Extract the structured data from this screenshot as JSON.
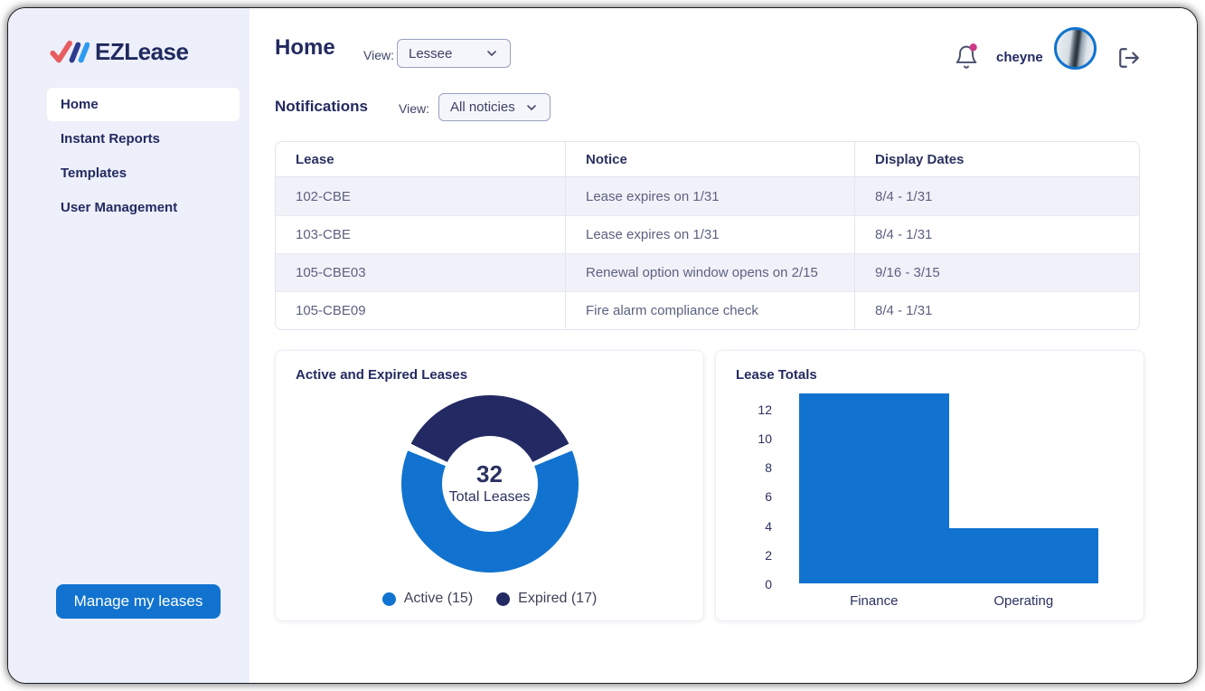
{
  "sidebar": {
    "logo_text": "EZLease",
    "items": [
      {
        "label": "Home",
        "active": true
      },
      {
        "label": "Instant Reports",
        "active": false
      },
      {
        "label": "Templates",
        "active": false
      },
      {
        "label": "User Management",
        "active": false
      }
    ],
    "manage_button_label": "Manage my leases"
  },
  "header": {
    "title": "Home",
    "view_label": "View:",
    "view_value": "Lessee",
    "username": "cheyne",
    "notification_badge": true
  },
  "notifications": {
    "title": "Notifications",
    "view_label": "View:",
    "view_value": "All noticies"
  },
  "table": {
    "columns": [
      "Lease",
      "Notice",
      "Display Dates"
    ],
    "rows": [
      {
        "lease": "102-CBE",
        "notice": "Lease expires on 1/31",
        "dates": "8/4 - 1/31"
      },
      {
        "lease": "103-CBE",
        "notice": "Lease expires on 1/31",
        "dates": "8/4 - 1/31"
      },
      {
        "lease": "105-CBE03",
        "notice": "Renewal option window opens on 2/15",
        "dates": "9/16 - 3/15"
      },
      {
        "lease": "105-CBE09",
        "notice": "Fire alarm compliance check",
        "dates": "8/4 - 1/31"
      }
    ]
  },
  "chart_data": [
    {
      "type": "pie",
      "title": "Active and Expired Leases",
      "center_value": "32",
      "center_label": "Total Leases",
      "segments": [
        {
          "name": "Active",
          "value": 15,
          "color": "#1173cf"
        },
        {
          "name": "Expired",
          "value": 17,
          "color": "#232a63"
        }
      ],
      "legend": [
        {
          "label": "Active (15)",
          "color": "#1173cf"
        },
        {
          "label": "Expired (17)",
          "color": "#232a63"
        }
      ],
      "legend_position": "bottom",
      "display_segments": [
        {
          "color": "#232a63",
          "from": -63,
          "to": 63
        },
        {
          "color": "#1173cf",
          "from": 68,
          "to": 292
        }
      ]
    },
    {
      "type": "bar",
      "title": "Lease Totals",
      "categories": [
        "Finance",
        "Operating"
      ],
      "values": [
        13,
        3.8
      ],
      "bar_color": "#1173cf",
      "ticks": [
        0,
        2,
        4,
        6,
        8,
        10,
        12
      ],
      "ylim": [
        0,
        13.4
      ],
      "grid": false
    }
  ],
  "colors": {
    "accent_blue": "#1173cf",
    "navy": "#232a60",
    "dark_segment": "#232a63",
    "sidebar_bg": "#edeffa",
    "alt_row": "#f1f2f9",
    "badge_pink": "#cc3a86",
    "logo_check_red": "#e85d60",
    "logo_slash_navy": "#2c3c8f",
    "logo_slash_blue": "#2e9bf0"
  }
}
